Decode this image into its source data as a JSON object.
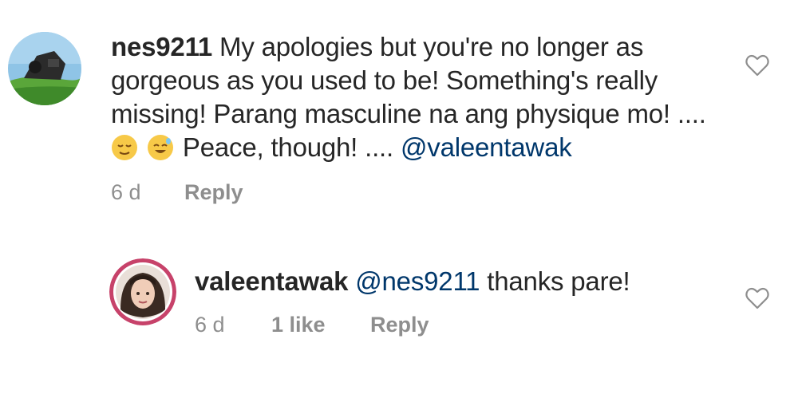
{
  "comments": [
    {
      "username": "nes9211",
      "text_part1": " My apologies but you're no longer as gorgeous as you used to be! Something's really missing! Parang masculine na ang physique mo! .... ",
      "text_part2": " Peace, though! .... ",
      "mention": "@valeentawak",
      "emojis": [
        "relieved-face",
        "grinning-sweat-face"
      ],
      "time": "6 d",
      "reply_label": "Reply"
    },
    {
      "username": "valeentawak",
      "mention": "@nes9211",
      "text": " thanks pare!",
      "time": "6 d",
      "likes": "1 like",
      "reply_label": "Reply"
    }
  ],
  "colors": {
    "text": "#262626",
    "mention": "#00376b",
    "meta": "#8e8e8e"
  }
}
